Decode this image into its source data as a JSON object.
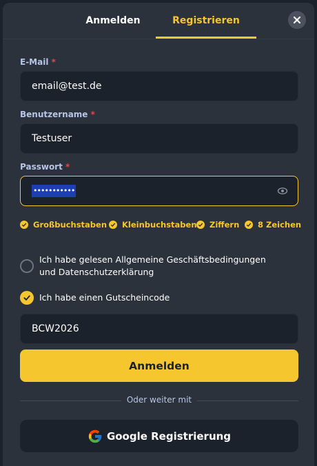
{
  "tabs": {
    "login": "Anmelden",
    "register": "Registrieren"
  },
  "form": {
    "email": {
      "label": "E-Mail",
      "required": "*",
      "value": "email@test.de"
    },
    "username": {
      "label": "Benutzername",
      "required": "*",
      "value": "Testuser"
    },
    "password": {
      "label": "Passwort",
      "required": "*",
      "masked_value": "•••••••••••"
    },
    "requirements": [
      "Großbuchstaben",
      "Kleinbuchstaben",
      "Ziffern",
      "8 Zeichen"
    ],
    "terms_text": "Ich habe gelesen Allgemeine Geschäftsbedingungen und Datenschutzerklärung",
    "voucher_text": "Ich habe einen Gutscheincode",
    "voucher_value": "BCW2026",
    "submit_label": "Anmelden",
    "divider_text": "Oder weiter mit",
    "google_label": "Google Registrierung"
  },
  "icons": {
    "close": "close-icon",
    "eye": "eye-icon",
    "check": "check-icon",
    "google": "google-icon"
  },
  "colors": {
    "accent": "#f5c62e",
    "panel": "#2b323c",
    "field": "#1c222b",
    "label": "#b8c4e6",
    "required": "#e04848"
  }
}
